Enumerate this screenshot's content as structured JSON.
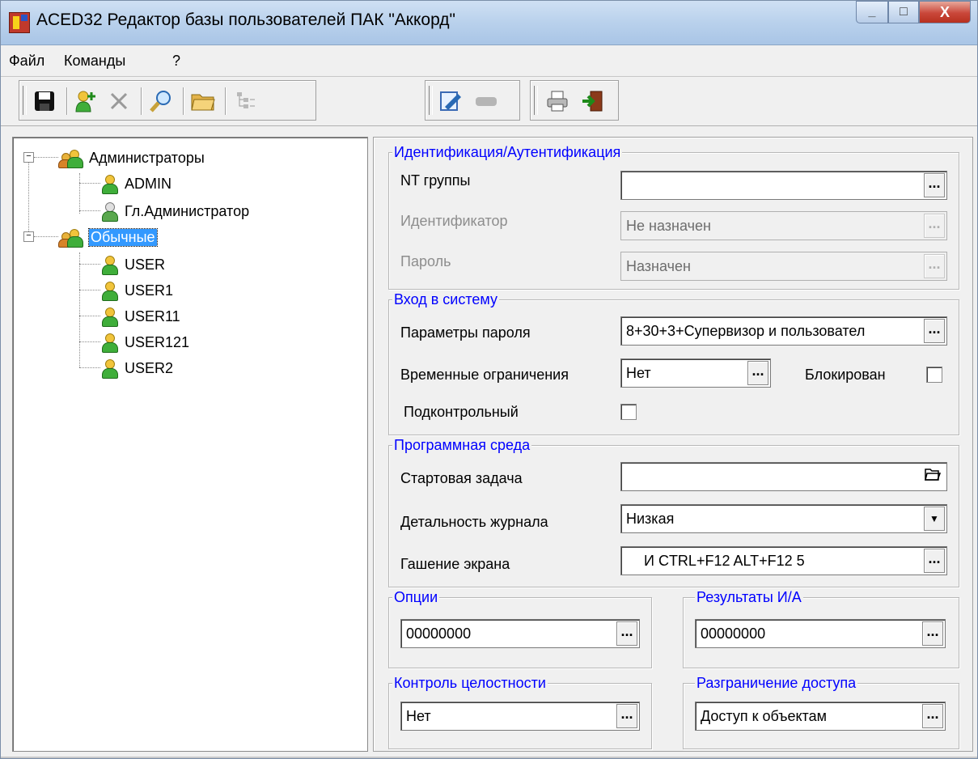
{
  "window": {
    "title": "ACED32 Редактор базы пользователей ПАК \"Аккорд\"",
    "minimize": "_",
    "maximize": "□",
    "close": "X"
  },
  "menu": [
    "Файл",
    "Команды",
    "?"
  ],
  "toolbar": {
    "icons": [
      "save-icon",
      "add-user-icon",
      "delete-icon",
      "find-icon",
      "open-folder-icon",
      "tree-icon",
      "edit-icon",
      "key-icon",
      "print-icon",
      "exit-icon"
    ]
  },
  "tree": {
    "groups": [
      {
        "label": "Администраторы",
        "expander": "−",
        "children": [
          "ADMIN",
          "Гл.Администратор"
        ]
      },
      {
        "label": "Обычные",
        "expander": "−",
        "selected": true,
        "children": [
          "USER",
          "USER1",
          "USER11",
          "USER121",
          "USER2"
        ]
      }
    ]
  },
  "ident": {
    "legend": "Идентификация/Аутентификация",
    "nt_groups_label": "NT группы",
    "nt_groups_value": "",
    "identifier_label": "Идентификатор",
    "identifier_value": "Не назначен",
    "password_label": "Пароль",
    "password_value": "Назначен"
  },
  "login": {
    "legend": "Вход в систему",
    "password_params_label": "Параметры пароля",
    "password_params_value": "8+30+3+Супервизор и пользовател",
    "time_limits_label": "Временные ограничения",
    "time_limits_value": "Нет",
    "blocked_label": "Блокирован",
    "controlled_label": "Подконтрольный"
  },
  "env": {
    "legend": "Программная среда",
    "start_task_label": "Стартовая задача",
    "start_task_value": "",
    "log_detail_label": "Детальность журнала",
    "log_detail_value": "Низкая",
    "screen_blank_label": "Гашение экрана",
    "screen_blank_value": "И CTRL+F12 ALT+F12 5"
  },
  "options": {
    "legend": "Опции",
    "value": "00000000"
  },
  "ia_results": {
    "legend": "Результаты И/А",
    "value": "00000000"
  },
  "integrity": {
    "legend": "Контроль целостности",
    "value": "Нет"
  },
  "access": {
    "legend": "Разграничение доступа",
    "value": "Доступ к объектам"
  },
  "ellipsis": "...",
  "colors": {
    "legend": "#0000ff",
    "selection": "#3399ff",
    "disabled_text": "#8d8d8d"
  }
}
